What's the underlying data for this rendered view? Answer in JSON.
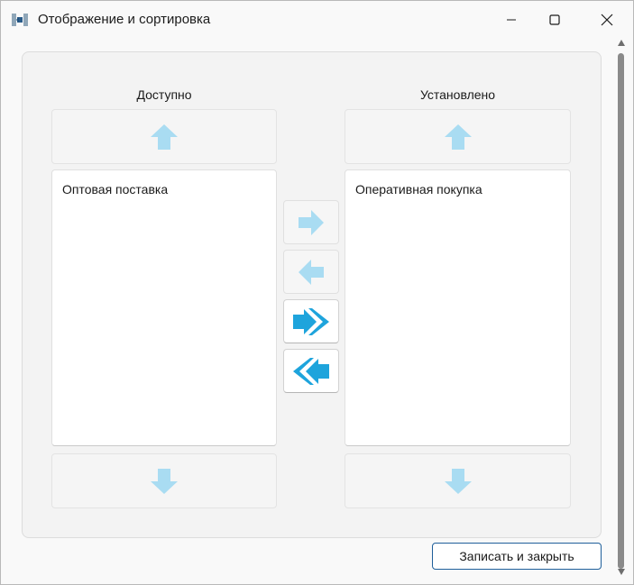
{
  "window": {
    "title": "Отображение и сортировка",
    "app_icon": "app-logo-icon",
    "controls": [
      "minimize-icon",
      "maximize-icon",
      "close-icon"
    ]
  },
  "available": {
    "title": "Доступно",
    "items": [
      "Оптовая поставка"
    ]
  },
  "installed": {
    "title": "Установлено",
    "items": [
      "Оперативная покупка"
    ]
  },
  "move_buttons": [
    {
      "icon": "arrow-right-icon",
      "enabled": false
    },
    {
      "icon": "arrow-left-icon",
      "enabled": false
    },
    {
      "icon": "double-arrow-right-icon",
      "enabled": true
    },
    {
      "icon": "double-arrow-left-icon",
      "enabled": true
    }
  ],
  "footer": {
    "save_label": "Записать и закрыть"
  },
  "colors": {
    "arrow_disabled": "#a9dcf2",
    "arrow_enabled": "#1ea4dc",
    "accent_border": "#1f5f9a"
  }
}
